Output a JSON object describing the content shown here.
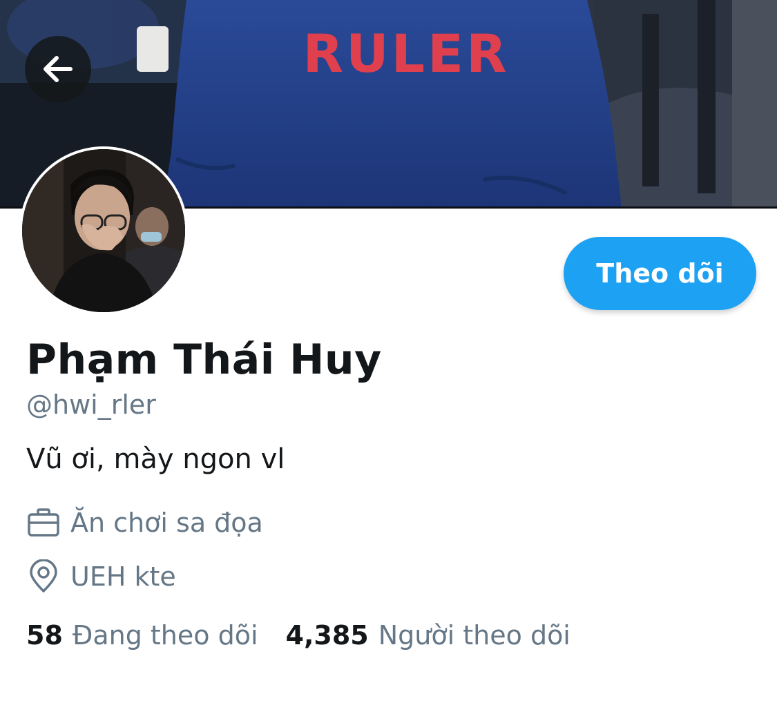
{
  "banner": {
    "jersey_text": "RULER"
  },
  "header": {
    "back_icon": "arrow-left-icon"
  },
  "profile": {
    "display_name": "Phạm Thái Huy",
    "handle": "@hwi_rler",
    "bio": "Vũ ơi, mày ngon vl",
    "occupation": "Ăn chơi sa đọa",
    "occupation_icon": "briefcase-icon",
    "location": "UEH kte",
    "location_icon": "location-pin-icon",
    "follow_label": "Theo dõi"
  },
  "stats": {
    "following_count": "58",
    "following_label": "Đang theo dõi",
    "followers_count": "4,385",
    "followers_label": "Người theo dõi"
  },
  "colors": {
    "accent": "#1da1f2",
    "primary_text": "#14171a",
    "secondary_text": "#657786",
    "jersey": "#1f3f8a",
    "jersey_text": "#e0404e"
  }
}
